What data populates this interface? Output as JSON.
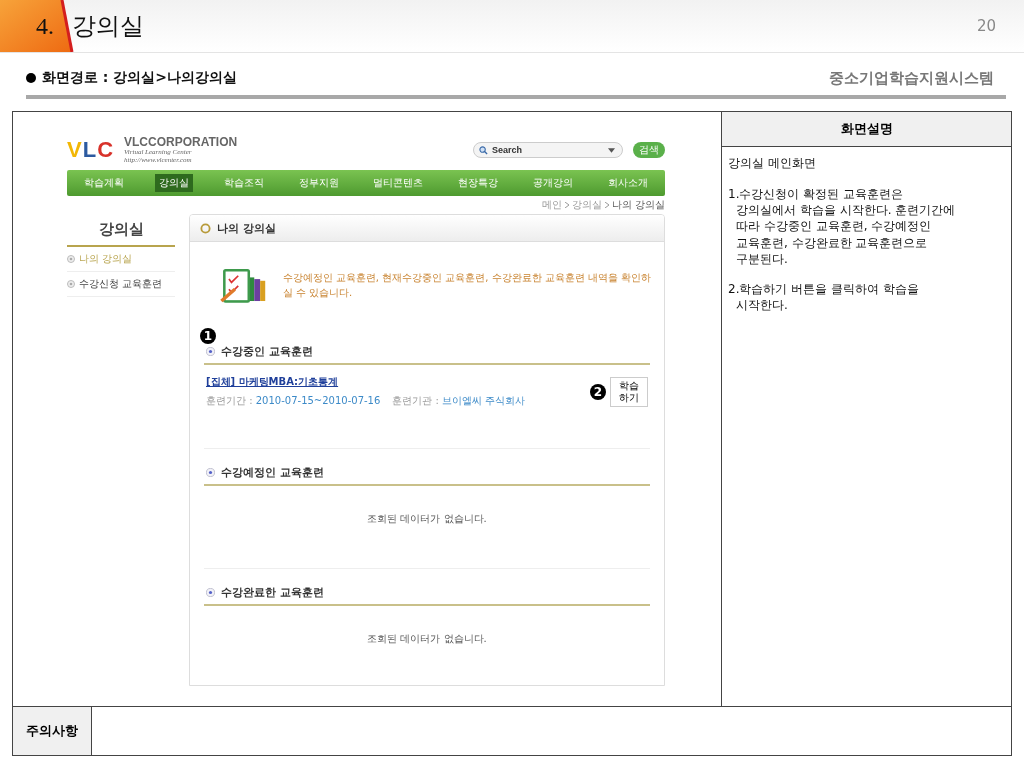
{
  "slide": {
    "number": "4.",
    "title": "강의실",
    "page": "20"
  },
  "path": {
    "text": "화면경로 : 강의실>나의강의실",
    "system": "중소기업학습지원시스템"
  },
  "web": {
    "logo": "VLC",
    "company": "VLCCORPORATION",
    "tagline": "Virtual Learning Center",
    "url": "http://www.vlcenter.com",
    "search": {
      "placeholder": "Search",
      "button": "검색"
    },
    "nav": [
      {
        "label": "학습계획",
        "selected": false
      },
      {
        "label": "강의실",
        "selected": true
      },
      {
        "label": "학습조직",
        "selected": false
      },
      {
        "label": "정부지원",
        "selected": false
      },
      {
        "label": "멀티콘텐츠",
        "selected": false
      },
      {
        "label": "현장특강",
        "selected": false
      },
      {
        "label": "공개강의",
        "selected": false
      },
      {
        "label": "회사소개",
        "selected": false
      }
    ],
    "breadcrumb": [
      "메인",
      "강의실",
      "나의 강의실"
    ],
    "sidebar": {
      "title": "강의실",
      "items": [
        {
          "label": "나의 강의실",
          "selected": true
        },
        {
          "label": "수강신청 교육훈련",
          "selected": false
        }
      ]
    },
    "panel": {
      "title": "나의 강의실",
      "intro": "수강예정인 교육훈련, 현재수강중인 교육훈련, 수강완료한 교육훈련 내역을 확인하실 수 있습니다.",
      "sections": [
        {
          "title": "수강중인 교육훈련",
          "marker": "1",
          "courses": [
            {
              "name": "[집체] 마케팅MBA:기초통계",
              "period_label": "훈련기간 : ",
              "period": "2010-07-15~2010-07-16",
              "org_label": "훈련기관 : ",
              "org": "브이엘씨 주식회사",
              "button": "학습\n하기",
              "marker": "2"
            }
          ]
        },
        {
          "title": "수강예정인 교육훈련",
          "empty": "조회된 데이터가 없습니다."
        },
        {
          "title": "수강완료한 교육훈련",
          "empty": "조회된 데이터가 없습니다."
        }
      ]
    }
  },
  "description": {
    "header": "화면설명",
    "heading": "강의실 메인화면",
    "paragraphs": [
      "1.수강신청이 확정된 교육훈련은\n강의실에서 학습을 시작한다. 훈련기간에\n따라 수강중인 교육훈련, 수강예정인\n교육훈련, 수강완료한 교육훈련으로\n구분된다.",
      "2.학습하기 버튼을 클릭하여 학습을\n시작한다."
    ]
  },
  "notes": {
    "label": "주의사항"
  }
}
